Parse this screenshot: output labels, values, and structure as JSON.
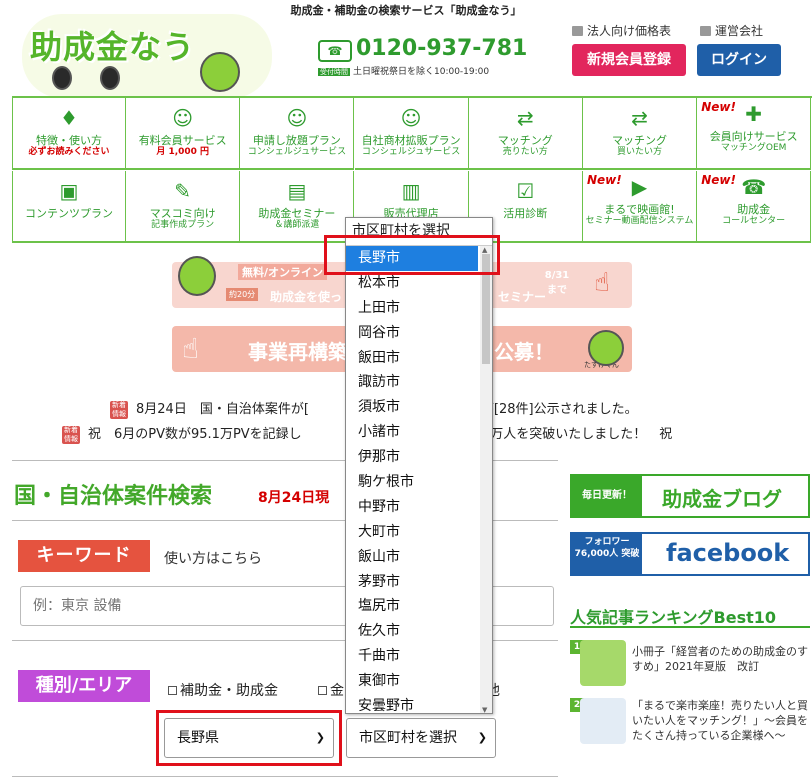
{
  "header": {
    "tagline": "助成金・補助金の検索サービス「助成金なう」",
    "logo": "助成金なう",
    "phone_icon": "受付時間",
    "phone": "0120-937-781",
    "phone_note": "土日曜祝祭日を除く10:00-19:00",
    "link_pricing": "法人向け価格表",
    "link_company": "運営会社",
    "register_button": "新規会員登録",
    "login_button": "ログイン"
  },
  "nav": {
    "row1": [
      {
        "line1": "特徴・使い方",
        "line2": "必ずお読みください",
        "icon": "leaf-icon",
        "glyph": "♦"
      },
      {
        "line1": "有料会員サービス",
        "line2": "月 1,000 円",
        "icon": "mascot-icon",
        "glyph": "☺"
      },
      {
        "line1": "申請し放題プラン",
        "line2": "コンシェルジュサービス",
        "icon": "mascot-icon",
        "glyph": "☺"
      },
      {
        "line1": "自社商材拡販プラン",
        "line2": "コンシェルジュサービス",
        "icon": "mascot-icon",
        "glyph": "☺"
      },
      {
        "line1": "マッチング",
        "line2": "売りたい方",
        "icon": "handshake-icon",
        "glyph": "⇄"
      },
      {
        "line1": "マッチング",
        "line2": "買いたい方",
        "icon": "handshake-icon",
        "glyph": "⇄"
      },
      {
        "line1": "会員向けサービス",
        "line2": "マッチングOEM",
        "icon": "puzzle-icon",
        "glyph": "✚",
        "new": "New!"
      }
    ],
    "row2": [
      {
        "line1": "コンテンツプラン",
        "line2": "",
        "icon": "browser-icon",
        "glyph": "▣"
      },
      {
        "line1": "マスコミ向け",
        "line2": "記事作成プラン",
        "icon": "book-icon",
        "glyph": "✎"
      },
      {
        "line1": "助成金セミナー",
        "line2": "＆講師派遣",
        "icon": "presentation-icon",
        "glyph": "▤"
      },
      {
        "line1": "販売代理店",
        "line2": "",
        "icon": "building-icon",
        "glyph": "▥"
      },
      {
        "line1": "活用診断",
        "line2": "",
        "icon": "clipboard-icon",
        "glyph": "☑"
      },
      {
        "line1": "まるで映画館!",
        "line2": "セミナー動画配信システム",
        "icon": "video-camera-icon",
        "glyph": "▶",
        "new": "New!"
      },
      {
        "line1": "助成金",
        "line2": "コールセンター",
        "icon": "headset-icon",
        "glyph": "☎",
        "new": "New!"
      }
    ]
  },
  "banners": {
    "seminar_small": "無料/オンライン",
    "seminar_text": "助成金を使っ",
    "seminar_tail": "セミナー",
    "seminar_date": "8/31 まで",
    "seminar_badge": "約20分",
    "restructure_left": "事業再構築",
    "restructure_right": "公募！",
    "mascot_name": "たすけくん"
  },
  "news": [
    {
      "badge": "新着情報",
      "pre": "8月24日　国・自治体案件が[",
      "post": "案件が[28件]公示されました。"
    },
    {
      "badge": "新着情報",
      "pre": "祝　6月のPV数が95.1万PVを記録し",
      "post": "数が10万人を突破いたしました！　祝"
    }
  ],
  "search": {
    "title": "国・自治体案件検索",
    "date": "8月24日現",
    "keyword_label": "キーワード",
    "keyword_help": "使い方はこちら",
    "keyword_placeholder": "例：東京 設備",
    "category_label": "種別/エリア",
    "checkbox_subsidy": "補助金・助成金",
    "checkbox_second": "金",
    "prefecture_value": "長野県",
    "city_value": "市区町村を選択"
  },
  "dropdown": {
    "header": "市区町村を選択",
    "items": [
      "長野市",
      "松本市",
      "上田市",
      "岡谷市",
      "飯田市",
      "諏訪市",
      "須坂市",
      "小諸市",
      "伊那市",
      "駒ケ根市",
      "中野市",
      "大町市",
      "飯山市",
      "茅野市",
      "塩尻市",
      "佐久市",
      "千曲市",
      "東御市",
      "安曇野市"
    ],
    "selected_index": 0
  },
  "sidebar": {
    "blog_tag": "毎日更新！",
    "blog_title": "助成金ブログ",
    "fb_tag": "フォロワー 76,000人 突破",
    "fb_title": "facebook",
    "ranking_title": "人気記事ランキングBest10",
    "ranking": [
      {
        "rank": "1",
        "text": "小冊子「経営者のための助成金のすすめ」2021年夏版　改訂"
      },
      {
        "rank": "2",
        "text": "「まるで楽市楽座！売りたい人と買いたい人をマッチング！」～会員をたくさん持っている企業様へ～"
      }
    ]
  },
  "colors": {
    "brand_green": "#43a82a",
    "accent_red": "#e0101a",
    "select_blue": "#1e7fe0"
  }
}
